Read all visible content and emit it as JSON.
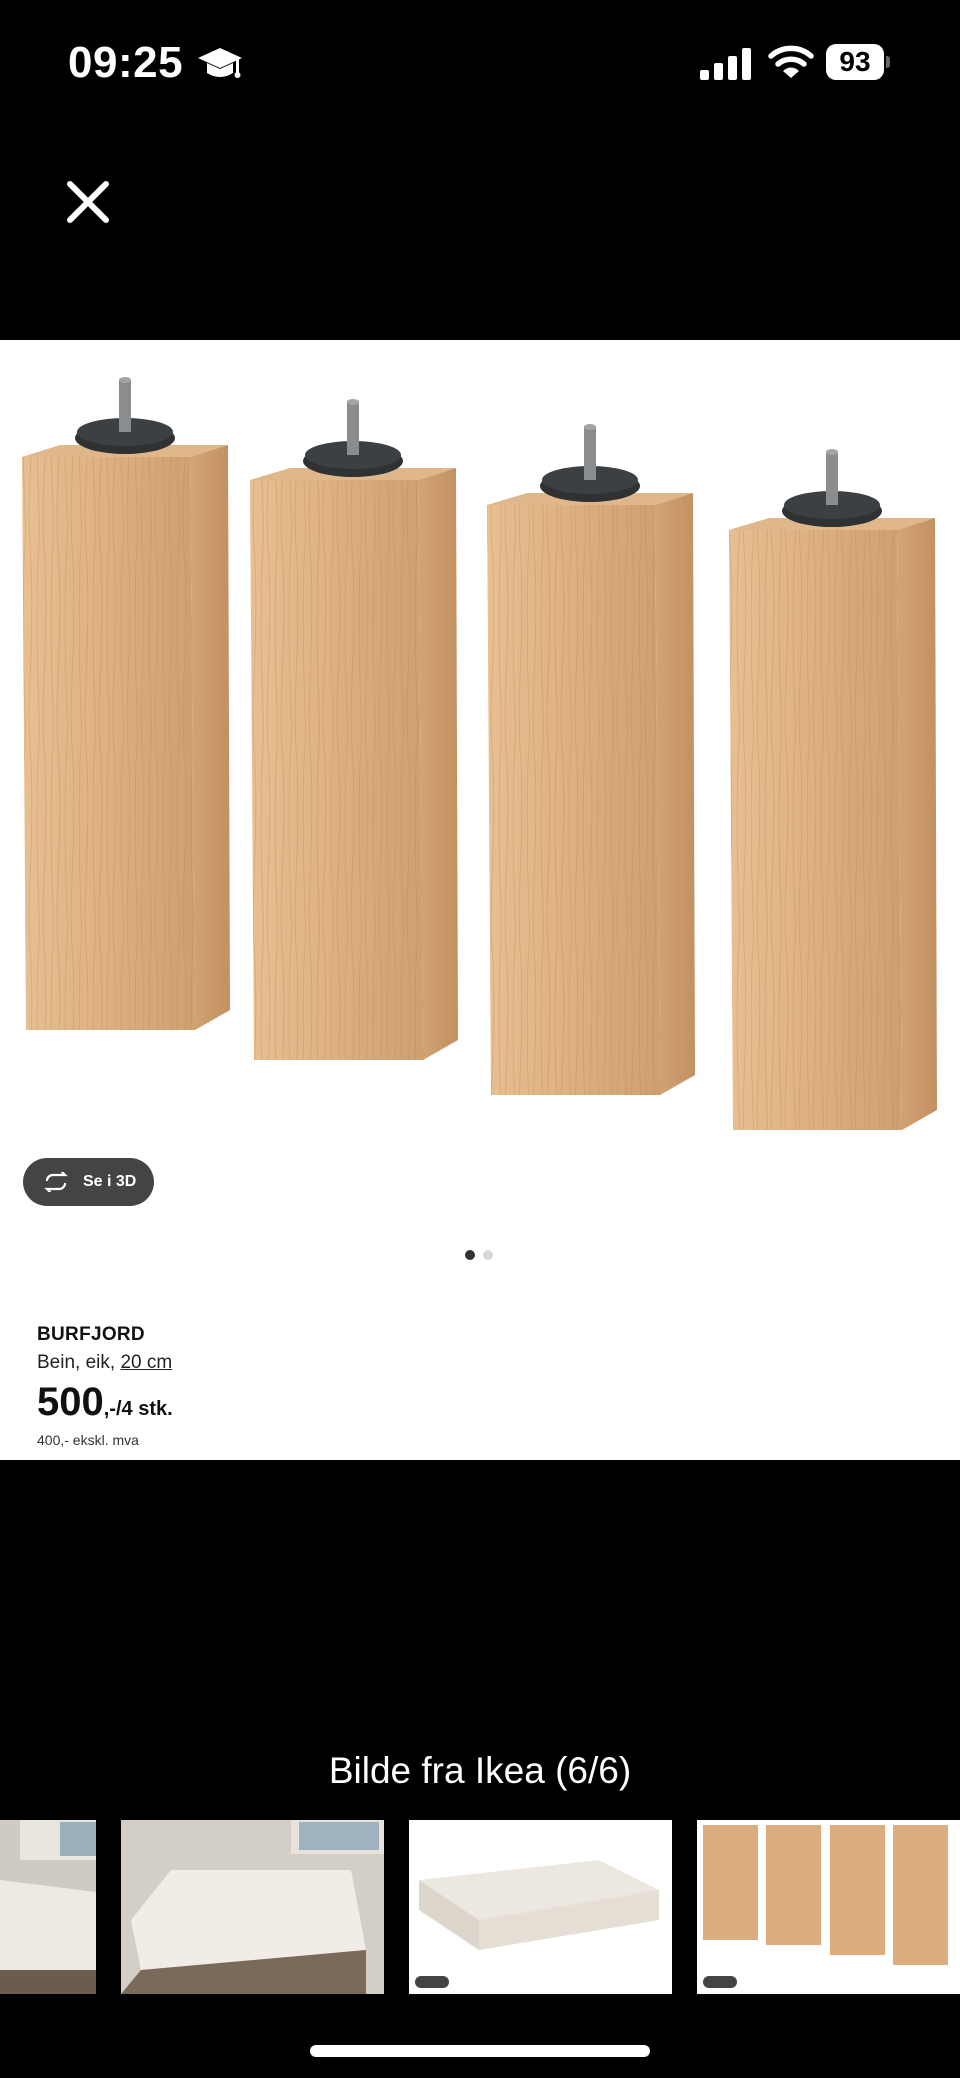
{
  "status_bar": {
    "time": "09:25",
    "battery": "93",
    "icons": [
      "graduation-cap-icon",
      "signal-icon",
      "wifi-icon",
      "battery-icon"
    ]
  },
  "viewer": {
    "close_icon": "close-icon",
    "caption": "Bilde fra Ikea (6/6)",
    "page_dots": {
      "count": 2,
      "active": 1
    }
  },
  "product": {
    "name": "BURFJORD",
    "desc_prefix": "Bein, eik, ",
    "desc_link": "20 cm",
    "price_main": "500",
    "price_unit": ",-/4 stk.",
    "price_ex_vat": "400,- ekskl. mva",
    "view_3d_label": "Se i 3D"
  },
  "thumbnails": [
    {
      "name": "bed-room-photo-partial"
    },
    {
      "name": "bed-room-photo"
    },
    {
      "name": "mattress-base"
    },
    {
      "name": "wooden-legs"
    }
  ],
  "colors": {
    "background": "#000000",
    "panel": "#ffffff",
    "wood": "#d9a878",
    "button_3d": "#444444"
  }
}
